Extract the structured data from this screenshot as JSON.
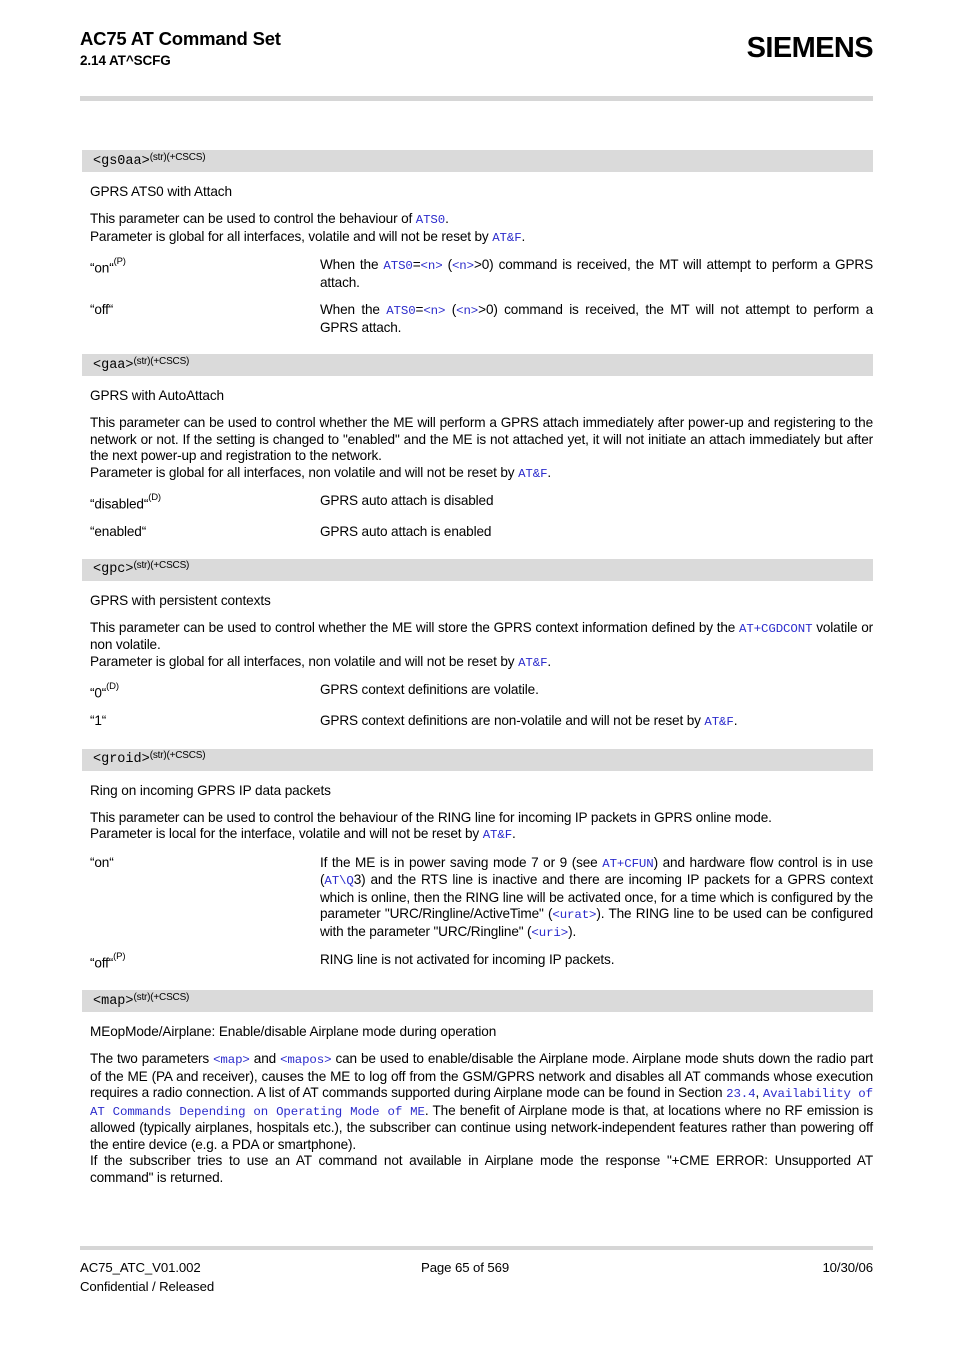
{
  "header": {
    "title": "AC75 AT Command Set",
    "subtitle": "2.14 AT^SCFG",
    "logo": "SIEMENS"
  },
  "footer": {
    "doc_id": "AC75_ATC_V01.002",
    "classification": "Confidential / Released",
    "page": "Page 65 of 569",
    "date": "10/30/06"
  },
  "colors": {
    "code_blue": "#2c2ccc",
    "bar_grey": "#dadada",
    "rule_grey": "#d6d6d6"
  },
  "sections": [
    {
      "param": "<gs0aa>",
      "param_sup": "(str)(+CSCS)",
      "title": "GPRS ATS0 with Attach",
      "paragraphs": [
        {
          "parts": [
            {
              "t": "This parameter can be used to control the behaviour of ",
              "k": "n"
            },
            {
              "t": "ATS0",
              "k": "c"
            },
            {
              "t": ".",
              "k": "n"
            }
          ]
        },
        {
          "tight": true,
          "parts": [
            {
              "t": "Parameter is global for all interfaces, volatile and will not be reset by ",
              "k": "n"
            },
            {
              "t": "AT&F",
              "k": "c"
            },
            {
              "t": ".",
              "k": "n"
            }
          ]
        }
      ],
      "values": [
        {
          "label": "“on“",
          "label_sup": "(P)",
          "desc_parts": [
            {
              "t": "When the ",
              "k": "n"
            },
            {
              "t": "ATS0",
              "k": "c"
            },
            {
              "t": "=",
              "k": "n"
            },
            {
              "t": "<n>",
              "k": "c"
            },
            {
              "t": " (",
              "k": "n"
            },
            {
              "t": "<n>",
              "k": "c"
            },
            {
              "t": ">0) command is received, the MT will attempt to perform a GPRS attach.",
              "k": "n"
            }
          ]
        },
        {
          "label": "“off“",
          "label_sup": "",
          "desc_parts": [
            {
              "t": "When the ",
              "k": "n"
            },
            {
              "t": "ATS0",
              "k": "c"
            },
            {
              "t": "=",
              "k": "n"
            },
            {
              "t": "<n>",
              "k": "c"
            },
            {
              "t": " (",
              "k": "n"
            },
            {
              "t": "<n>",
              "k": "c"
            },
            {
              "t": ">0) command is received, the MT will not attempt to perform a GPRS attach.",
              "k": "n"
            }
          ]
        }
      ]
    },
    {
      "param": "<gaa>",
      "param_sup": "(str)(+CSCS)",
      "title": "GPRS with AutoAttach",
      "paragraphs": [
        {
          "parts": [
            {
              "t": "This parameter can be used to control whether the ME will perform a GPRS attach immediately after power-up and registering to the network or not. If the setting is changed to \"enabled\" and the ME is not attached yet, it will not initiate an attach immediately but after the next power-up and registration to the network.",
              "k": "n"
            }
          ]
        },
        {
          "tight": true,
          "parts": [
            {
              "t": "Parameter is global for all interfaces, non volatile and will not be reset by ",
              "k": "n"
            },
            {
              "t": "AT&F",
              "k": "c"
            },
            {
              "t": ".",
              "k": "n"
            }
          ]
        }
      ],
      "values": [
        {
          "label": "“disabled“",
          "label_sup": "(D)",
          "desc_parts": [
            {
              "t": "GPRS auto attach is disabled",
              "k": "n"
            }
          ]
        },
        {
          "label": "“enabled“",
          "label_sup": "",
          "desc_parts": [
            {
              "t": "GPRS auto attach is enabled",
              "k": "n"
            }
          ]
        }
      ]
    },
    {
      "param": "<gpc>",
      "param_sup": "(str)(+CSCS)",
      "title": "GPRS with persistent contexts",
      "paragraphs": [
        {
          "parts": [
            {
              "t": "This parameter can be used to control whether the ME will store the GPRS context information defined by the ",
              "k": "n"
            },
            {
              "t": "AT+CGDCONT",
              "k": "c"
            },
            {
              "t": " volatile or non volatile.",
              "k": "n"
            }
          ]
        },
        {
          "tight": true,
          "parts": [
            {
              "t": "Parameter is global for all interfaces, non volatile and will not be reset by ",
              "k": "n"
            },
            {
              "t": "AT&F",
              "k": "c"
            },
            {
              "t": ".",
              "k": "n"
            }
          ]
        }
      ],
      "values": [
        {
          "label": "“0“",
          "label_sup": "(D)",
          "desc_parts": [
            {
              "t": "GPRS context definitions are volatile.",
              "k": "n"
            }
          ]
        },
        {
          "label": "“1“",
          "label_sup": "",
          "desc_parts": [
            {
              "t": "GPRS context definitions are non-volatile and will not be reset by ",
              "k": "n"
            },
            {
              "t": "AT&F",
              "k": "c"
            },
            {
              "t": ".",
              "k": "n"
            }
          ]
        }
      ]
    },
    {
      "param": "<groid>",
      "param_sup": "(str)(+CSCS)",
      "title": "Ring on incoming GPRS IP data packets",
      "paragraphs": [
        {
          "parts": [
            {
              "t": "This parameter can be used to control the behaviour of the RING line for incoming IP packets in GPRS online mode.",
              "k": "n"
            }
          ]
        },
        {
          "tight": true,
          "parts": [
            {
              "t": "Parameter is local for the interface, volatile and will not be reset by ",
              "k": "n"
            },
            {
              "t": "AT&F",
              "k": "c"
            },
            {
              "t": ".",
              "k": "n"
            }
          ]
        }
      ],
      "values": [
        {
          "label": "“on“",
          "label_sup": "",
          "desc_parts": [
            {
              "t": "If the ME is in power saving mode 7 or 9 (see ",
              "k": "n"
            },
            {
              "t": "AT+CFUN",
              "k": "c"
            },
            {
              "t": ") and hardware flow control is in use (",
              "k": "n"
            },
            {
              "t": "AT\\Q",
              "k": "c"
            },
            {
              "t": "3) and the RTS line is inactive and there are incoming IP packets for a GPRS context which is online, then the RING line will be activated once, for a time which is configured by the parameter \"URC/Ringline/ActiveTime\" (",
              "k": "n"
            },
            {
              "t": "<urat>",
              "k": "c"
            },
            {
              "t": "). The RING line to be used can be configured with the parameter \"URC/Ringline\" (",
              "k": "n"
            },
            {
              "t": "<uri>",
              "k": "c"
            },
            {
              "t": ").",
              "k": "n"
            }
          ]
        },
        {
          "label": "“off“",
          "label_sup": "(P)",
          "desc_parts": [
            {
              "t": "RING line is not activated for incoming IP packets.",
              "k": "n"
            }
          ]
        }
      ]
    },
    {
      "param": "<map>",
      "param_sup": "(str)(+CSCS)",
      "title": "MEopMode/Airplane: Enable/disable Airplane mode during operation",
      "paragraphs": [
        {
          "parts": [
            {
              "t": "The two parameters ",
              "k": "n"
            },
            {
              "t": "<map>",
              "k": "c"
            },
            {
              "t": " and ",
              "k": "n"
            },
            {
              "t": "<mapos>",
              "k": "c"
            },
            {
              "t": " can be used to enable/disable the Airplane mode. Airplane mode shuts down the radio part of the ME (PA and receiver), causes the ME to log off from the GSM/GPRS network and disables all AT commands whose execution requires a radio connection. A list of AT commands supported during Airplane mode can be found in Section ",
              "k": "n"
            },
            {
              "t": "23.4",
              "k": "c"
            },
            {
              "t": ", ",
              "k": "n"
            },
            {
              "t": "Availability of AT Commands Depending on Operating Mode of ME",
              "k": "c"
            },
            {
              "t": ". The benefit of Airplane mode is that, at locations where no RF emission is allowed (typically airplanes, hospitals etc.), the subscriber can continue using network-independent features rather than powering off the entire device (e.g. a PDA or smartphone).",
              "k": "n"
            }
          ]
        },
        {
          "tight": true,
          "parts": [
            {
              "t": "If the subscriber tries to use an AT command not available in Airplane mode the response \"+CME ERROR: Unsupported AT command\" is returned.",
              "k": "n"
            }
          ]
        }
      ],
      "values": []
    }
  ]
}
